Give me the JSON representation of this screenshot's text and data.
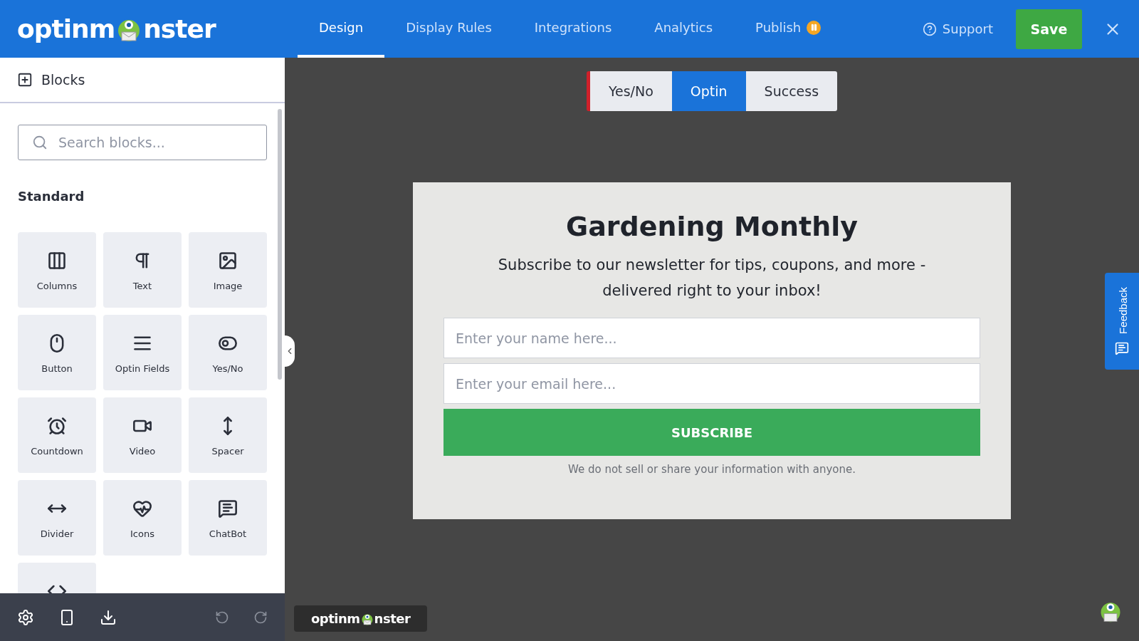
{
  "logo": {
    "before": "optinm",
    "after": "nster"
  },
  "nav": [
    {
      "label": "Design",
      "selected": true
    },
    {
      "label": "Display Rules",
      "selected": false
    },
    {
      "label": "Integrations",
      "selected": false
    },
    {
      "label": "Analytics",
      "selected": false
    },
    {
      "label": "Publish",
      "selected": false,
      "paused": true
    }
  ],
  "support": "Support",
  "save": "Save",
  "sidebar": {
    "title": "Blocks",
    "search": {
      "placeholder": "Search blocks..."
    },
    "section": "Standard",
    "blocks": [
      {
        "kind": "columns",
        "label": "Columns"
      },
      {
        "kind": "text",
        "label": "Text"
      },
      {
        "kind": "image",
        "label": "Image"
      },
      {
        "kind": "button",
        "label": "Button"
      },
      {
        "kind": "fields",
        "label": "Optin Fields"
      },
      {
        "kind": "yesno",
        "label": "Yes/No"
      },
      {
        "kind": "countdown",
        "label": "Countdown"
      },
      {
        "kind": "video",
        "label": "Video"
      },
      {
        "kind": "spacer",
        "label": "Spacer"
      },
      {
        "kind": "divider",
        "label": "Divider"
      },
      {
        "kind": "icons",
        "label": "Icons"
      },
      {
        "kind": "chatbot",
        "label": "ChatBot"
      },
      {
        "kind": "code"
      }
    ]
  },
  "views": [
    {
      "label": "Yes/No",
      "selected": false
    },
    {
      "label": "Optin",
      "selected": true
    },
    {
      "label": "Success",
      "selected": false
    }
  ],
  "popup": {
    "title": "Gardening Monthly",
    "subtitle": "Subscribe to our newsletter for tips, coupons, and more - delivered right to your inbox!",
    "name_field": {
      "placeholder": "Enter your name here..."
    },
    "email_field": {
      "placeholder": "Enter your email here..."
    },
    "button": "SUBSCRIBE",
    "note": "We do not sell or share your information with anyone."
  },
  "feedback": "Feedback",
  "badge": {
    "before": "optinm",
    "after": "nster"
  }
}
